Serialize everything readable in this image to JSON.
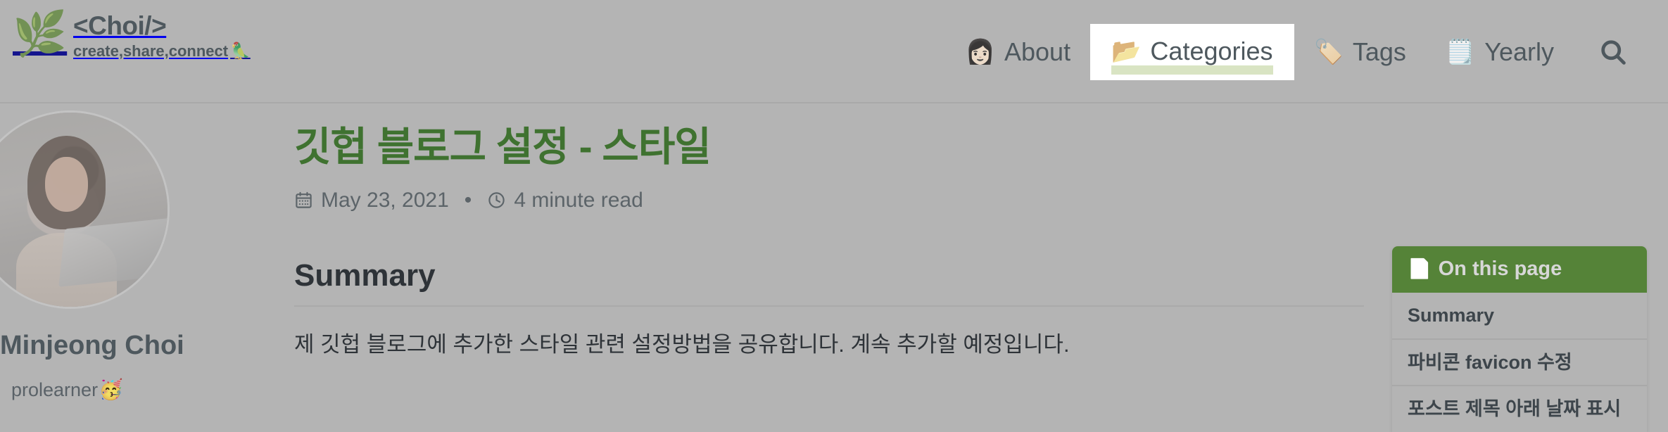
{
  "site": {
    "logo_icon": "leaf-icon",
    "title": "<Choi/>",
    "tagline": "create,share,connect",
    "tagline_emoji": "🦜"
  },
  "nav": {
    "items": [
      {
        "icon": "woman-face-icon",
        "emoji": "👩🏻",
        "label": "About",
        "active": false
      },
      {
        "icon": "folder-icon",
        "emoji": "📂",
        "label": "Categories",
        "active": true
      },
      {
        "icon": "tag-icon",
        "emoji": "🏷️",
        "label": "Tags",
        "active": false
      },
      {
        "icon": "spiral-notepad-icon",
        "emoji": "🗒️",
        "label": "Yearly",
        "active": false
      }
    ],
    "search_icon": "search-icon"
  },
  "author": {
    "avatar_alt": "Minjeong Choi profile photo",
    "name": "Minjeong Choi",
    "bio": "prolearner",
    "bio_emoji": "🥳"
  },
  "post": {
    "title": "깃헙 블로그 설정 - 스타일",
    "date_icon": "calendar-icon",
    "date": "May 23, 2021",
    "separator": "•",
    "readtime_icon": "clock-icon",
    "read_time": "4 minute read",
    "section_heading": "Summary",
    "paragraph": "제 깃헙 블로그에 추가한 스타일 관련 설정방법을 공유합니다. 계속 추가할 예정입니다."
  },
  "toc": {
    "icon": "page-facing-up-icon",
    "header_emoji": "📄",
    "title": "On this page",
    "items": [
      {
        "label": "Summary"
      },
      {
        "label": "파비콘 favicon 수정"
      },
      {
        "label": "포스트 제목 아래 날짜 표시"
      }
    ]
  },
  "colors": {
    "page_background": "#b4b4b4",
    "brand_text": "#4e585e",
    "post_title_green": "#3f7230",
    "toc_header_green": "#558338",
    "active_nav_underline": "#d9e4c3",
    "active_nav_background": "#ffffff"
  }
}
